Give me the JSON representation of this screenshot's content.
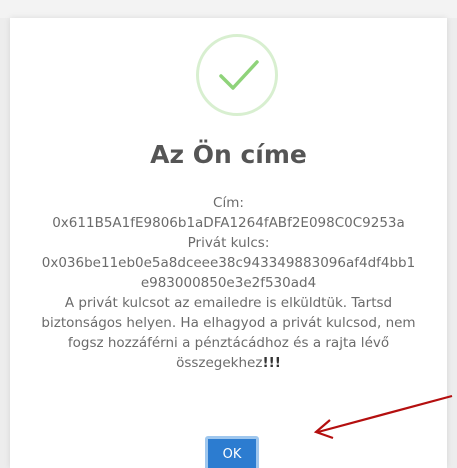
{
  "dialog": {
    "icon": "check-icon",
    "title": "Az Ön címe",
    "address_label": "Cím:",
    "address_value": "0x611B5A1fE9806b1aDFA1264fABf2E098C0C9253a",
    "private_key_label": "Privát kulcs:",
    "private_key_line1": "0x036be11eb0e5a8dceee38c943349883096af4df4bb1",
    "private_key_line2": "e983000850e3e2f530ad4",
    "message": "A privát kulcsot az emailedre is elküldtük. Tartsd biztonságos helyen. Ha elhagyod a privát kulcsod, nem fogsz hozzáférni a pénztácádhoz és a rajta lévő összegekhez",
    "message_emphasis": "!!!",
    "ok_label": "OK"
  },
  "colors": {
    "accent": "#2c7cd0",
    "check_green": "#8fd37a",
    "circle_border": "#d8efd0",
    "arrow_red": "#b40f0f"
  }
}
